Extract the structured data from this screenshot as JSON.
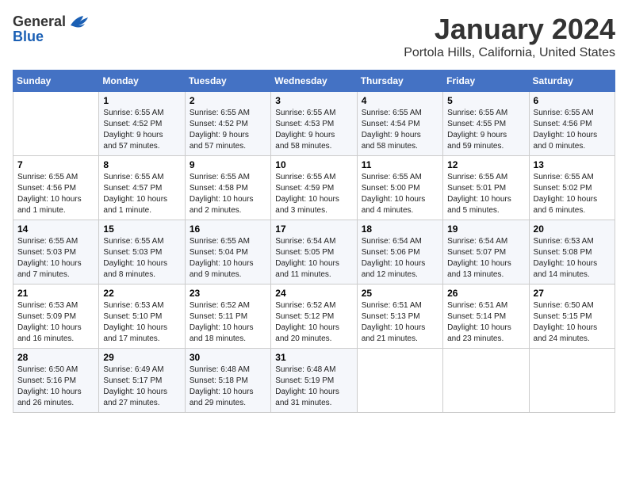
{
  "logo": {
    "general": "General",
    "blue": "Blue"
  },
  "title": "January 2024",
  "location": "Portola Hills, California, United States",
  "days_of_week": [
    "Sunday",
    "Monday",
    "Tuesday",
    "Wednesday",
    "Thursday",
    "Friday",
    "Saturday"
  ],
  "weeks": [
    [
      {
        "day": "",
        "info": ""
      },
      {
        "day": "1",
        "info": "Sunrise: 6:55 AM\nSunset: 4:52 PM\nDaylight: 9 hours\nand 57 minutes."
      },
      {
        "day": "2",
        "info": "Sunrise: 6:55 AM\nSunset: 4:52 PM\nDaylight: 9 hours\nand 57 minutes."
      },
      {
        "day": "3",
        "info": "Sunrise: 6:55 AM\nSunset: 4:53 PM\nDaylight: 9 hours\nand 58 minutes."
      },
      {
        "day": "4",
        "info": "Sunrise: 6:55 AM\nSunset: 4:54 PM\nDaylight: 9 hours\nand 58 minutes."
      },
      {
        "day": "5",
        "info": "Sunrise: 6:55 AM\nSunset: 4:55 PM\nDaylight: 9 hours\nand 59 minutes."
      },
      {
        "day": "6",
        "info": "Sunrise: 6:55 AM\nSunset: 4:56 PM\nDaylight: 10 hours\nand 0 minutes."
      }
    ],
    [
      {
        "day": "7",
        "info": "Sunrise: 6:55 AM\nSunset: 4:56 PM\nDaylight: 10 hours\nand 1 minute."
      },
      {
        "day": "8",
        "info": "Sunrise: 6:55 AM\nSunset: 4:57 PM\nDaylight: 10 hours\nand 1 minute."
      },
      {
        "day": "9",
        "info": "Sunrise: 6:55 AM\nSunset: 4:58 PM\nDaylight: 10 hours\nand 2 minutes."
      },
      {
        "day": "10",
        "info": "Sunrise: 6:55 AM\nSunset: 4:59 PM\nDaylight: 10 hours\nand 3 minutes."
      },
      {
        "day": "11",
        "info": "Sunrise: 6:55 AM\nSunset: 5:00 PM\nDaylight: 10 hours\nand 4 minutes."
      },
      {
        "day": "12",
        "info": "Sunrise: 6:55 AM\nSunset: 5:01 PM\nDaylight: 10 hours\nand 5 minutes."
      },
      {
        "day": "13",
        "info": "Sunrise: 6:55 AM\nSunset: 5:02 PM\nDaylight: 10 hours\nand 6 minutes."
      }
    ],
    [
      {
        "day": "14",
        "info": "Sunrise: 6:55 AM\nSunset: 5:03 PM\nDaylight: 10 hours\nand 7 minutes."
      },
      {
        "day": "15",
        "info": "Sunrise: 6:55 AM\nSunset: 5:03 PM\nDaylight: 10 hours\nand 8 minutes."
      },
      {
        "day": "16",
        "info": "Sunrise: 6:55 AM\nSunset: 5:04 PM\nDaylight: 10 hours\nand 9 minutes."
      },
      {
        "day": "17",
        "info": "Sunrise: 6:54 AM\nSunset: 5:05 PM\nDaylight: 10 hours\nand 11 minutes."
      },
      {
        "day": "18",
        "info": "Sunrise: 6:54 AM\nSunset: 5:06 PM\nDaylight: 10 hours\nand 12 minutes."
      },
      {
        "day": "19",
        "info": "Sunrise: 6:54 AM\nSunset: 5:07 PM\nDaylight: 10 hours\nand 13 minutes."
      },
      {
        "day": "20",
        "info": "Sunrise: 6:53 AM\nSunset: 5:08 PM\nDaylight: 10 hours\nand 14 minutes."
      }
    ],
    [
      {
        "day": "21",
        "info": "Sunrise: 6:53 AM\nSunset: 5:09 PM\nDaylight: 10 hours\nand 16 minutes."
      },
      {
        "day": "22",
        "info": "Sunrise: 6:53 AM\nSunset: 5:10 PM\nDaylight: 10 hours\nand 17 minutes."
      },
      {
        "day": "23",
        "info": "Sunrise: 6:52 AM\nSunset: 5:11 PM\nDaylight: 10 hours\nand 18 minutes."
      },
      {
        "day": "24",
        "info": "Sunrise: 6:52 AM\nSunset: 5:12 PM\nDaylight: 10 hours\nand 20 minutes."
      },
      {
        "day": "25",
        "info": "Sunrise: 6:51 AM\nSunset: 5:13 PM\nDaylight: 10 hours\nand 21 minutes."
      },
      {
        "day": "26",
        "info": "Sunrise: 6:51 AM\nSunset: 5:14 PM\nDaylight: 10 hours\nand 23 minutes."
      },
      {
        "day": "27",
        "info": "Sunrise: 6:50 AM\nSunset: 5:15 PM\nDaylight: 10 hours\nand 24 minutes."
      }
    ],
    [
      {
        "day": "28",
        "info": "Sunrise: 6:50 AM\nSunset: 5:16 PM\nDaylight: 10 hours\nand 26 minutes."
      },
      {
        "day": "29",
        "info": "Sunrise: 6:49 AM\nSunset: 5:17 PM\nDaylight: 10 hours\nand 27 minutes."
      },
      {
        "day": "30",
        "info": "Sunrise: 6:48 AM\nSunset: 5:18 PM\nDaylight: 10 hours\nand 29 minutes."
      },
      {
        "day": "31",
        "info": "Sunrise: 6:48 AM\nSunset: 5:19 PM\nDaylight: 10 hours\nand 31 minutes."
      },
      {
        "day": "",
        "info": ""
      },
      {
        "day": "",
        "info": ""
      },
      {
        "day": "",
        "info": ""
      }
    ]
  ]
}
